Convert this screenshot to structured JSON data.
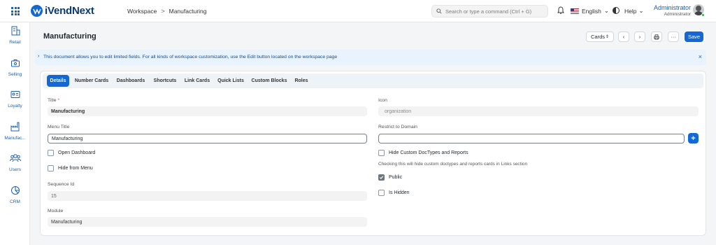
{
  "app": {
    "name": "iVendNext",
    "logo_letter": "iV"
  },
  "breadcrumb": {
    "parent": "Workspace",
    "separator": ">",
    "current": "Manufacturing"
  },
  "search": {
    "placeholder": "Search or type a command (Ctrl + G)"
  },
  "navbar": {
    "language": "English",
    "help": "Help",
    "user_name": "Administrator",
    "user_role": "Administrator"
  },
  "sidebar": {
    "items": [
      {
        "label": "Retail",
        "icon": "retail-icon"
      },
      {
        "label": "Selling",
        "icon": "selling-icon"
      },
      {
        "label": "Loyalty",
        "icon": "loyalty-icon"
      },
      {
        "label": "Manufac...",
        "icon": "manufacturing-icon"
      },
      {
        "label": "Users",
        "icon": "users-icon"
      },
      {
        "label": "CRM",
        "icon": "crm-icon"
      }
    ]
  },
  "page": {
    "title": "Manufacturing"
  },
  "toolbar": {
    "cards_label": "Cards",
    "save_label": "Save"
  },
  "banner": {
    "message": "This document allows you to edit limited fields. For all kinds of workspace customization, use the Edit button located on the workspace page"
  },
  "tabs": [
    "Details",
    "Number Cards",
    "Dashboards",
    "Shortcuts",
    "Link Cards",
    "Quick Lists",
    "Custom Blocks",
    "Roles"
  ],
  "form": {
    "title_label": "Title",
    "title_required": "*",
    "title_value": "Manufacturing",
    "menu_title_label": "Menu Title",
    "menu_title_value": "Manufacturing",
    "open_dashboard_label": "Open Dashboard",
    "hide_from_menu_label": "Hide from Menu",
    "sequence_label": "Sequence Id",
    "sequence_value": "15",
    "module_label": "Module",
    "module_value": "Manufacturing",
    "icon_label": "Icon",
    "icon_value": "organization",
    "restrict_label": "Restrict to Domain",
    "restrict_value": "",
    "hide_custom_label": "Hide Custom DocTypes and Reports",
    "hide_custom_help": "Checking this will hide custom doctypes and reports cards in Links section",
    "public_label": "Public",
    "public_checked": true,
    "is_hidden_label": "Is Hidden"
  },
  "colors": {
    "primary": "#1468d5",
    "banner_bg": "#e8f3fd",
    "brand": "#0b3a73"
  }
}
